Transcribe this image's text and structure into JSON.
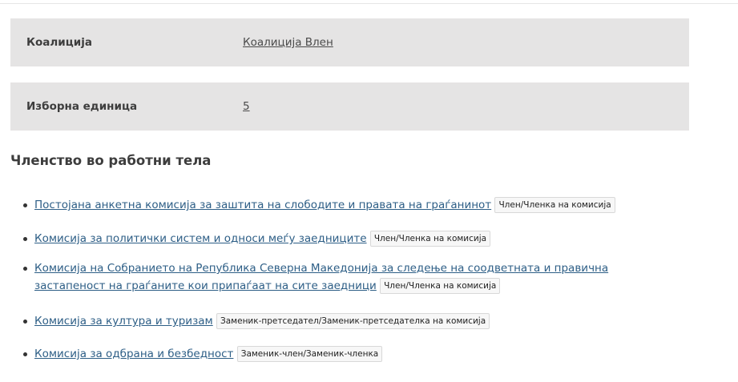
{
  "info": {
    "coalition_label": "Коалиција",
    "coalition_value": "Коалиција Влен",
    "district_label": "Изборна единица",
    "district_value": "5"
  },
  "membership": {
    "title": "Членство во работни тела",
    "items": [
      {
        "name": "Постојана анкетна комисија за заштита на слободите и правата на граѓанинот",
        "role": "Член/Членка на комисија"
      },
      {
        "name": "Комисија за политички систем и односи меѓу заедниците",
        "role": "Член/Членка на комисија"
      },
      {
        "name": "Комисија на Собранието на Република Северна Македонија за следење на соодветната и правична застапеност на граѓаните кои припаѓаат на сите заедници",
        "role": "Член/Членка на комисија"
      },
      {
        "name": "Комисија за култура и туризам",
        "role": "Заменик-претседател/Заменик-претседателка на комисија"
      },
      {
        "name": "Комисија за одбрана и безбедност",
        "role": "Заменик-член/Заменик-членка"
      }
    ]
  }
}
